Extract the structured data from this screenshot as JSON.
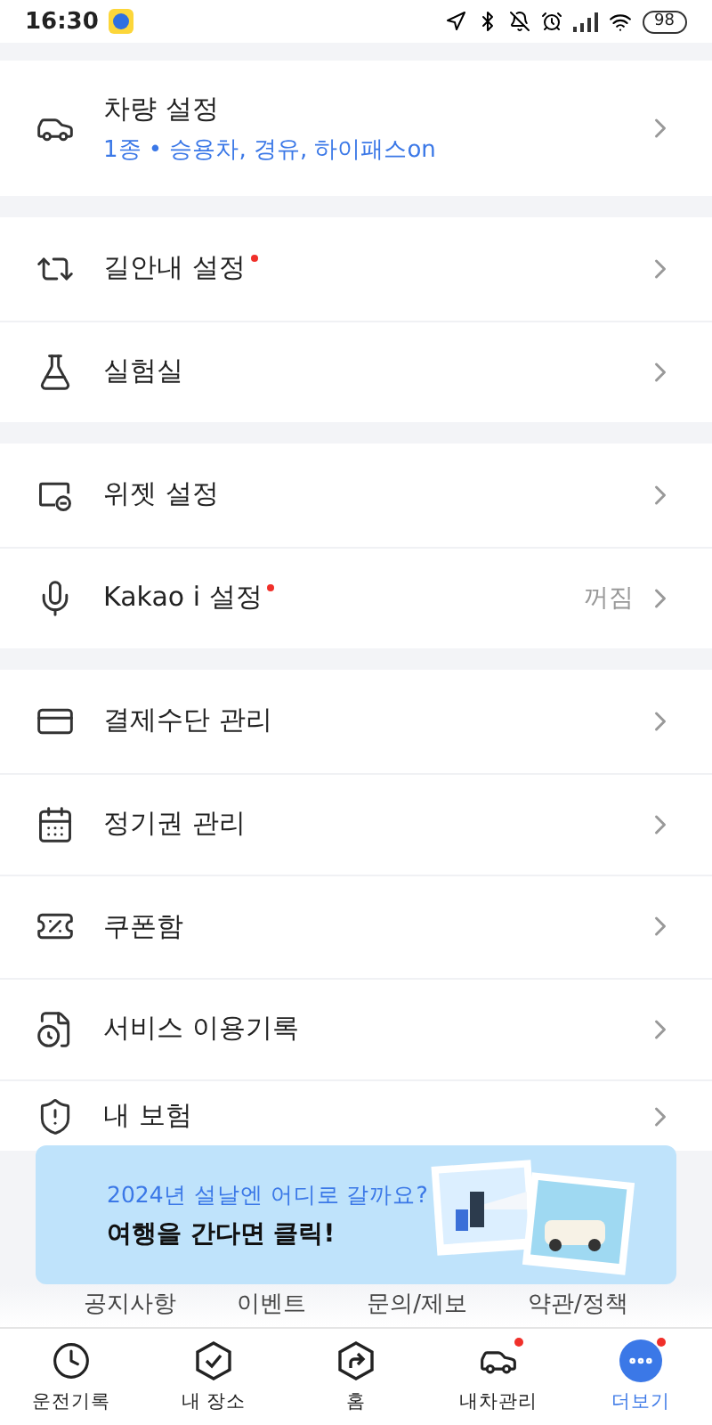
{
  "status_bar": {
    "time": "16:30",
    "battery": "98"
  },
  "sections": [
    {
      "items": [
        {
          "label": "차량 설정",
          "subtitle": "1종 • 승용차, 경유, 하이패스on",
          "badge": false
        }
      ]
    },
    {
      "items": [
        {
          "label": "길안내 설정",
          "badge": true
        },
        {
          "label": "실험실",
          "badge": false
        }
      ]
    },
    {
      "items": [
        {
          "label": "위젯 설정",
          "badge": false
        },
        {
          "label": "Kakao i 설정",
          "badge": true,
          "value": "꺼짐"
        }
      ]
    },
    {
      "items": [
        {
          "label": "결제수단 관리",
          "badge": false
        },
        {
          "label": "정기권 관리",
          "badge": false
        },
        {
          "label": "쿠폰함",
          "badge": false
        },
        {
          "label": "서비스 이용기록",
          "badge": false
        },
        {
          "label": "내 보험",
          "badge": false
        }
      ]
    }
  ],
  "banner": {
    "subtitle": "2024년 설날엔 어디로 갈까요?",
    "title": "여행을 간다면 클릭!"
  },
  "footer_links": [
    "공지사항",
    "이벤트",
    "문의/제보",
    "약관/정책"
  ],
  "tab_bar": [
    {
      "label": "운전기록",
      "selected": false,
      "badge": false
    },
    {
      "label": "내 장소",
      "selected": false,
      "badge": false
    },
    {
      "label": "홈",
      "selected": false,
      "badge": false
    },
    {
      "label": "내차관리",
      "selected": false,
      "badge": true
    },
    {
      "label": "더보기",
      "selected": true,
      "badge": true
    }
  ]
}
